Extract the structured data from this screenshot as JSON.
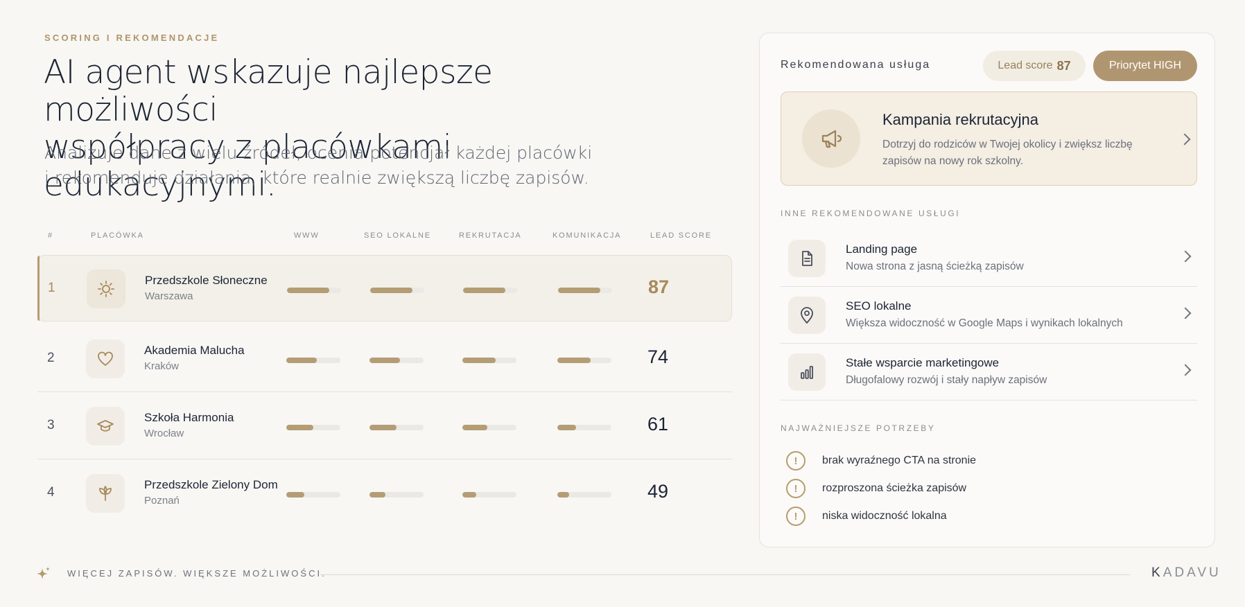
{
  "eyebrow": "SCORING I REKOMENDACJE",
  "headline": {
    "line1": "AI agent wskazuje najlepsze możliwości",
    "line2": "współpracy z placówkami edukacyjnymi."
  },
  "subheadline": {
    "line1": "Analizuje dane z wielu źródeł, ocenia potencjał każdej placówki",
    "line2": "i rekomenduje działania, które realnie zwiększą liczbę zapisów."
  },
  "table": {
    "headers": {
      "rank": "#",
      "facility": "PLACÓWKA",
      "www": "WWW",
      "seo": "SEO LOKALNE",
      "recruitment": "REKRUTACJA",
      "communication": "KOMUNIKACJA",
      "lead_score": "LEAD SCORE"
    },
    "rows": [
      {
        "rank": "1",
        "name": "Przedszkole Słoneczne",
        "city": "Warszawa",
        "icon": "sun-icon",
        "www": 0.78,
        "seo": 0.78,
        "recruitment": 0.78,
        "communication": 0.78,
        "score": "87",
        "highlighted": true
      },
      {
        "rank": "2",
        "name": "Akademia Malucha",
        "city": "Kraków",
        "icon": "heart-icon",
        "www": 0.57,
        "seo": 0.57,
        "recruitment": 0.62,
        "communication": 0.62,
        "score": "74",
        "highlighted": false
      },
      {
        "rank": "3",
        "name": "Szkoła Harmonia",
        "city": "Wrocław",
        "icon": "graduation-cap-icon",
        "www": 0.5,
        "seo": 0.5,
        "recruitment": 0.46,
        "communication": 0.34,
        "score": "61",
        "highlighted": false
      },
      {
        "rank": "4",
        "name": "Przedszkole Zielony Dom",
        "city": "Poznań",
        "icon": "sprout-icon",
        "www": 0.33,
        "seo": 0.3,
        "recruitment": 0.26,
        "communication": 0.22,
        "score": "49",
        "highlighted": false
      }
    ]
  },
  "panel": {
    "title": "Rekomendowana usługa",
    "lead_label": "Lead score",
    "lead_value": "87",
    "priority": "Priorytet HIGH",
    "featured": {
      "icon": "megaphone-icon",
      "title": "Kampania rekrutacyjna",
      "description": "Dotrzyj do rodziców w Twojej okolicy i zwiększ liczbę zapisów na nowy rok szkolny."
    },
    "other_title": "INNE REKOMENDOWANE USŁUGI",
    "services": [
      {
        "icon": "document-icon",
        "title": "Landing page",
        "description": "Nowa strona z jasną ścieżką zapisów"
      },
      {
        "icon": "map-pin-icon",
        "title": "SEO lokalne",
        "description": "Większa widoczność w Google Maps i wynikach lokalnych"
      },
      {
        "icon": "bar-chart-icon",
        "title": "Stałe wsparcie marketingowe",
        "description": "Długofalowy rozwój i stały napływ zapisów"
      }
    ],
    "needs_title": "NAJWAŻNIEJSZE POTRZEBY",
    "needs": [
      "brak wyraźnego CTA na stronie",
      "rozproszona ścieżka zapisów",
      "niska widoczność lokalna"
    ]
  },
  "footer": {
    "tagline": "WIĘCEJ ZAPISÓW. WIĘKSZE MOŻLIWOŚCI.",
    "brand_first": "K",
    "brand_rest": "ADAVU"
  },
  "colors": {
    "accent": "#b09670",
    "background": "#f8f7f4",
    "text": "#1c2434"
  }
}
